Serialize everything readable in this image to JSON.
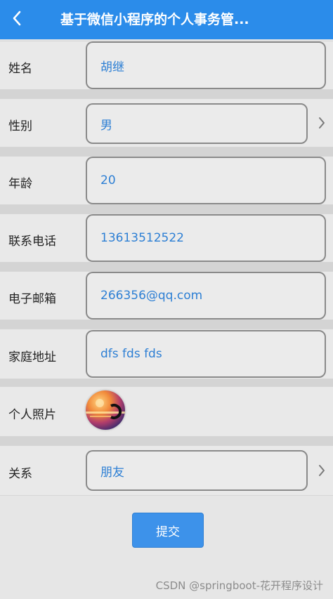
{
  "navbar": {
    "title": "基于微信小程序的个人事务管...",
    "back_icon": "chevron-left-icon",
    "background": "#2b8cea"
  },
  "form": {
    "name": {
      "label": "姓名",
      "value": "胡继"
    },
    "gender": {
      "label": "性别",
      "value": "男"
    },
    "age": {
      "label": "年龄",
      "value": "20"
    },
    "phone": {
      "label": "联系电话",
      "value": "13613512522"
    },
    "email": {
      "label": "电子邮箱",
      "value": "266356@qq.com"
    },
    "address": {
      "label": "家庭地址",
      "value": "dfs fds fds"
    },
    "photo": {
      "label": "个人照片"
    },
    "relation": {
      "label": "关系",
      "value": "朋友"
    }
  },
  "submit": {
    "label": "提交",
    "color": "#3d92ea"
  },
  "watermark": "CSDN @springboot-花开程序设计",
  "colors": {
    "value_text": "#2d7fd4"
  }
}
